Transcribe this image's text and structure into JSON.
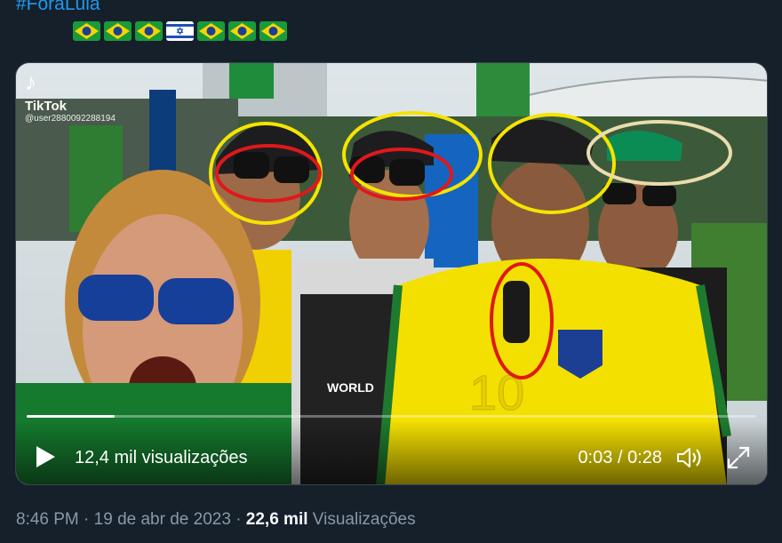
{
  "tweet": {
    "hashtag": "#ForaLula",
    "flags": [
      "brazil",
      "brazil",
      "brazil",
      "israel",
      "brazil",
      "brazil",
      "brazil"
    ]
  },
  "video": {
    "watermark_logo": "♪",
    "watermark_brand": "TikTok",
    "watermark_user": "@user2880092288194",
    "progress": 0.12,
    "views_label": "12,4 mil visualizações",
    "current_time": "0:03",
    "time_separator": "/",
    "duration": "0:28",
    "icons": [
      "play-icon",
      "volume-icon",
      "fullscreen-icon"
    ]
  },
  "footer": {
    "time": "8:46 PM",
    "separator": "·",
    "date": "19 de abr de 2023",
    "views_count": "22,6 mil",
    "views_word": "Visualizações"
  },
  "colors": {
    "accent": "#1d9bf0",
    "background": "#15202b",
    "muted": "#8b98a5",
    "yellow_circle": "#f5e400",
    "red_circle": "#e0181b",
    "beige_circle": "#e9dcae"
  }
}
